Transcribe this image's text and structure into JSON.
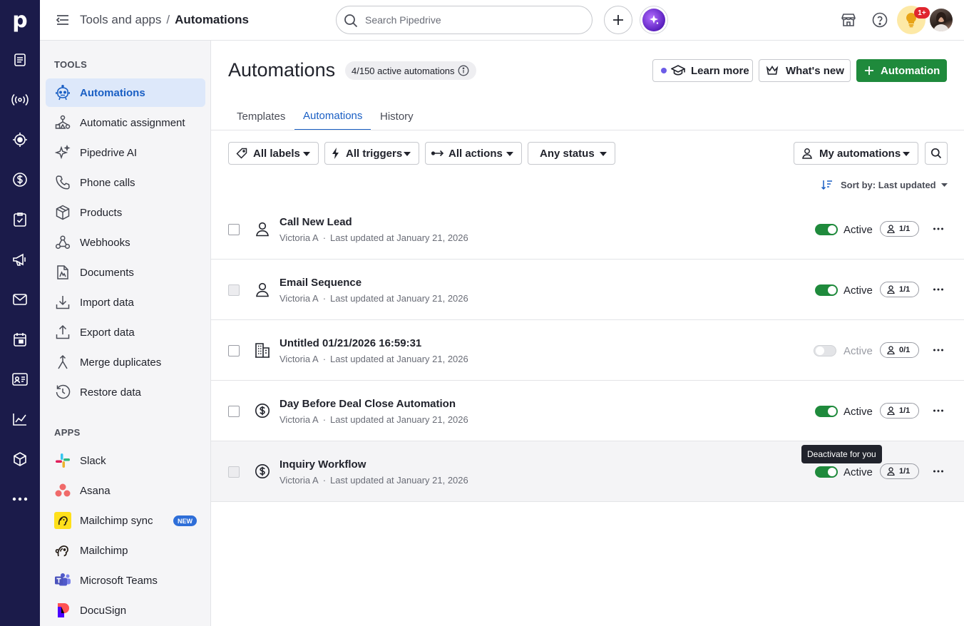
{
  "app": {
    "logo_letter": "p"
  },
  "header": {
    "breadcrumb_parent": "Tools and apps",
    "breadcrumb_separator": "/",
    "breadcrumb_current": "Automations",
    "search_placeholder": "Search Pipedrive",
    "notifications_badge": "1+"
  },
  "sidebar": {
    "tools_heading": "TOOLS",
    "tools": [
      {
        "label": "Automations",
        "active": true
      },
      {
        "label": "Automatic assignment"
      },
      {
        "label": "Pipedrive AI"
      },
      {
        "label": "Phone calls"
      },
      {
        "label": "Products"
      },
      {
        "label": "Webhooks"
      },
      {
        "label": "Documents"
      },
      {
        "label": "Import data"
      },
      {
        "label": "Export data"
      },
      {
        "label": "Merge duplicates"
      },
      {
        "label": "Restore data"
      }
    ],
    "apps_heading": "APPS",
    "apps": [
      {
        "label": "Slack"
      },
      {
        "label": "Asana"
      },
      {
        "label": "Mailchimp sync",
        "badge": "NEW"
      },
      {
        "label": "Mailchimp"
      },
      {
        "label": "Microsoft Teams"
      },
      {
        "label": "DocuSign"
      }
    ]
  },
  "main": {
    "title": "Automations",
    "active_count": "4/150 active automations",
    "learn_more": "Learn more",
    "whats_new": "What's new",
    "new_automation": "Automation",
    "tabs": [
      "Templates",
      "Automations",
      "History"
    ],
    "active_tab": "Automations",
    "filters": {
      "labels": "All labels",
      "triggers": "All triggers",
      "actions": "All actions",
      "status": "Any status",
      "owner": "My automations"
    },
    "sort_label": "Sort by: Last updated",
    "rows": [
      {
        "name": "Call New Lead",
        "owner": "Victoria A",
        "updated": "Last updated at January 21, 2026",
        "status": "Active",
        "enabled": true,
        "shared": "1/1",
        "icon": "person-icon"
      },
      {
        "name": "Email Sequence",
        "owner": "Victoria A",
        "updated": "Last updated at January 21, 2026",
        "status": "Active",
        "enabled": true,
        "shared": "1/1",
        "icon": "person-icon"
      },
      {
        "name": "Untitled 01/21/2026 16:59:31",
        "owner": "Victoria A",
        "updated": "Last updated at January 21, 2026",
        "status": "Active",
        "enabled": false,
        "shared": "0/1",
        "icon": "building-icon"
      },
      {
        "name": "Day Before Deal Close Automation",
        "owner": "Victoria A",
        "updated": "Last updated at January 21, 2026",
        "status": "Active",
        "enabled": true,
        "shared": "1/1",
        "icon": "dollar-icon"
      },
      {
        "name": "Inquiry Workflow",
        "owner": "Victoria A",
        "updated": "Last updated at January 21, 2026",
        "status": "Active",
        "enabled": true,
        "shared": "1/1",
        "icon": "dollar-icon"
      }
    ],
    "tooltip": "Deactivate for you",
    "meta_separator": "·"
  },
  "colors": {
    "rail": "#1b1b4a",
    "accent": "#1a5fc4",
    "primary_green": "#1f8a3c"
  }
}
